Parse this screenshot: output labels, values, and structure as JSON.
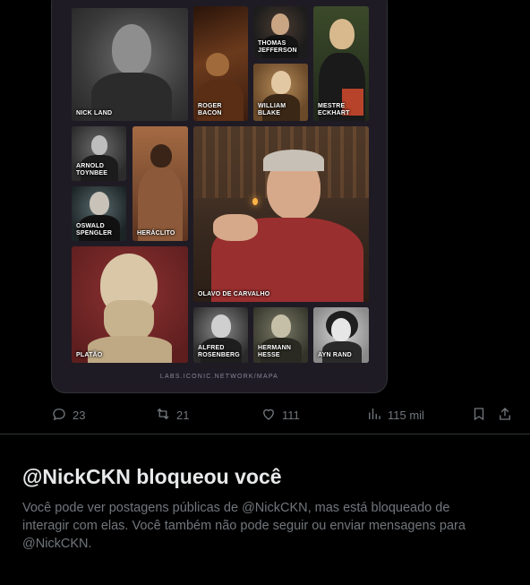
{
  "media": {
    "tiles": [
      {
        "label": "NICK LAND"
      },
      {
        "label": "ROGER BACON"
      },
      {
        "label": "THOMAS JEFFERSON"
      },
      {
        "label": "WILLIAM BLAKE"
      },
      {
        "label": "MESTRE ECKHART"
      },
      {
        "label": "ARNOLD TOYNBEE"
      },
      {
        "label": "OSWALD SPENGLER"
      },
      {
        "label": "HERÁCLITO"
      },
      {
        "label": "OLAVO DE CARVALHO"
      },
      {
        "label": "PLATÃO"
      },
      {
        "label": "ALFRED ROSENBERG"
      },
      {
        "label": "HERMANN HESSE"
      },
      {
        "label": "AYN RAND"
      }
    ],
    "source": "LABS.ICONIC.NETWORK/MAPA"
  },
  "actions": {
    "replies": "23",
    "reposts": "21",
    "likes": "111",
    "views": "115 mil"
  },
  "blocked": {
    "title": "@NickCKN bloqueou você",
    "description": "Você pode ver postagens públicas de @NickCKN, mas está bloqueado de interagir com elas. Você também não pode seguir ou enviar mensagens para @NickCKN."
  },
  "colors": {
    "background": "#000000",
    "text_primary": "#e7e9ea",
    "text_secondary": "#71767b",
    "card": "#1f1b24"
  },
  "icons": [
    "reply-icon",
    "repost-icon",
    "like-icon",
    "views-icon",
    "bookmark-icon",
    "share-icon"
  ]
}
